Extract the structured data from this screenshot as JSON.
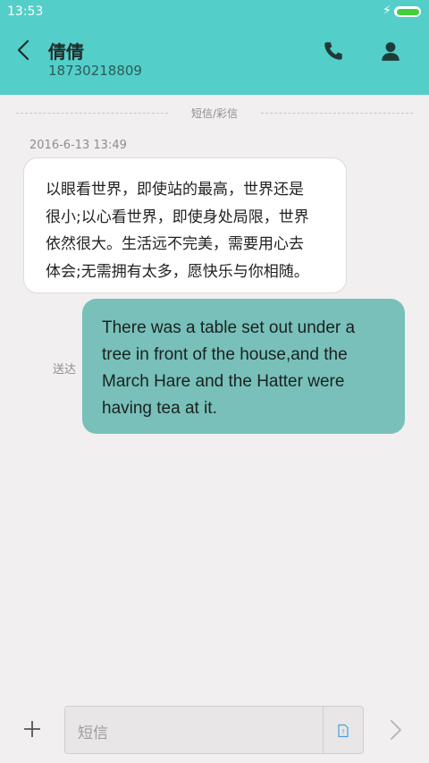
{
  "status_bar": {
    "time": "13:53",
    "battery_level": 1.0
  },
  "header": {
    "contact_name": "倩倩",
    "phone_number": "18730218809",
    "accent": "#54cec8"
  },
  "thread": {
    "channel_label": "短信/彩信",
    "timestamp": "2016-6-13 13:49",
    "incoming": {
      "lines": [
        "以眼看世界，即使站的最高，世界还是",
        "很小;以心看世界，即使身处局限，世界",
        "依然很大。生活远不完美，需要用心去",
        "体会;无需拥有太多，愿快乐与你相随。"
      ]
    },
    "outgoing": {
      "lines": [
        "There was a table set out under a",
        "tree in front of the house,and the",
        "March Hare and the Hatter were",
        "having tea at it."
      ],
      "status": "送达",
      "color": "#78c0b9"
    }
  },
  "composer": {
    "placeholder": "短信"
  },
  "icons": {
    "back": "chevron-left-icon",
    "call": "phone-icon",
    "profile": "person-icon",
    "attach": "plus-icon",
    "sim": "sim-card-icon",
    "send": "chevron-right-icon"
  }
}
